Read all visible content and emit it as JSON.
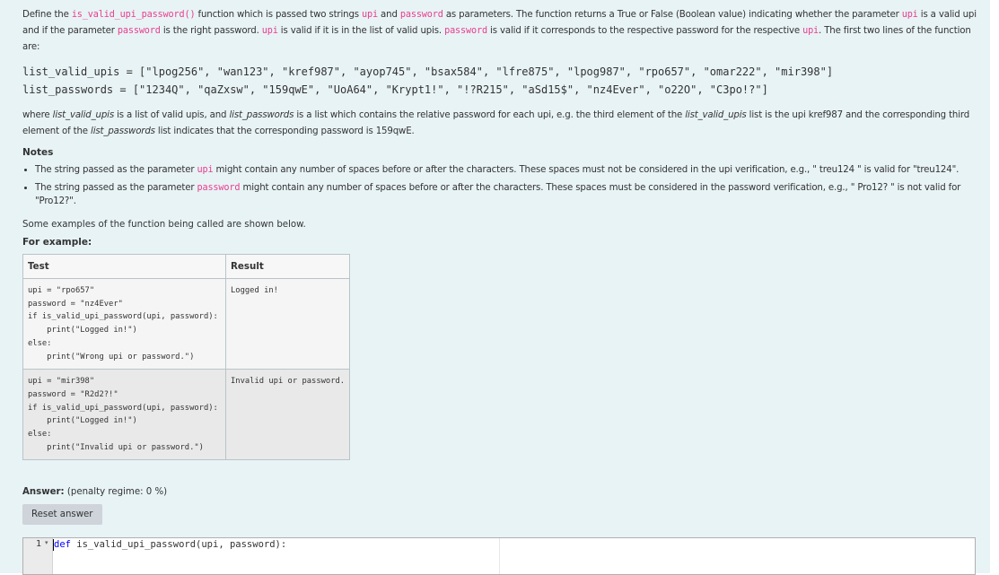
{
  "question": {
    "intro": {
      "p1": "Define the ",
      "fn": "is_valid_upi_password()",
      "p2": " function which is passed two strings ",
      "upi1": "upi",
      "p3": " and ",
      "pw1": "password",
      "p4": " as parameters. The function returns a True or False (Boolean value) indicating whether the parameter ",
      "upi2": "upi",
      "p5": " is a valid upi and if the parameter ",
      "pw2": "password",
      "p6": " is the right password. ",
      "upi3": "upi",
      "p7": " is valid if it is in the list of valid upis. ",
      "pw3": "password",
      "p8": " is valid if it corresponds to the respective password for the respective ",
      "upi4": "upi",
      "p9": ". The first two lines of the function are:"
    },
    "code_lines": [
      "list_valid_upis = [\"lpog256\", \"wan123\", \"kref987\", \"ayop745\", \"bsax584\", \"lfre875\", \"lpog987\", \"rpo657\", \"omar222\", \"mir398\"]",
      "list_passwords = [\"1234Q\", \"qaZxsw\", \"159qwE\", \"UoA64\", \"Krypt1!\", \"!?R215\", \"aSd15$\", \"nz4Ever\", \"o22O\", \"C3po!?\"]"
    ],
    "where": {
      "w1": "where ",
      "e1": "list_valid_upis",
      "w2": " is a list of valid upis, and ",
      "e2": "list_passwords",
      "w3": " is a list which contains the relative password for each upi, e.g. the third element of the ",
      "e3": "list_valid_upis",
      "w4": " list is the upi kref987 and the corresponding third element of the ",
      "e4": "list_passwords",
      "w5": " list indicates that the corresponding password is 159qwE."
    },
    "notes_heading": "Notes",
    "note1": {
      "a": "The string passed as the parameter ",
      "k": "upi",
      "b": " might contain any number of spaces before or after the characters. These spaces must not be considered in the upi verification, e.g., \"   treu124 \" is valid for \"treu124\"."
    },
    "note2": {
      "a": "The string passed as the parameter ",
      "k": "password",
      "b": " might contain any number of spaces before or after the characters. These spaces must be considered in the password verification, e.g., \"  Pro12?    \" is not valid for \"Pro12?\"."
    },
    "examples_intro": "Some examples of the function being called are shown below.",
    "for_example": "For example:"
  },
  "tests_table": {
    "headers": [
      "Test",
      "Result"
    ],
    "rows": [
      {
        "test": "upi = \"rpo657\"\npassword = \"nz4Ever\"\nif is_valid_upi_password(upi, password):\n    print(\"Logged in!\")\nelse:\n    print(\"Wrong upi or password.\")",
        "result": "Logged in!"
      },
      {
        "test": "upi = \"mir398\"\npassword = \"R2d2?!\"\nif is_valid_upi_password(upi, password):\n    print(\"Logged in!\")\nelse:\n    print(\"Invalid upi or password.\")",
        "result": "Invalid upi or password."
      }
    ]
  },
  "answer": {
    "label": "Answer:",
    "penalty": "(penalty regime: 0 %)",
    "reset_label": "Reset answer"
  },
  "editor": {
    "line_number": "1",
    "fold_marker": "▾",
    "keyword": "def",
    "rest": " is_valid_upi_password(upi, password):"
  },
  "colors": {
    "panel_bg": "#e8f3f6",
    "inline_code": "#e83e8c",
    "keyword": "#0000ff"
  }
}
